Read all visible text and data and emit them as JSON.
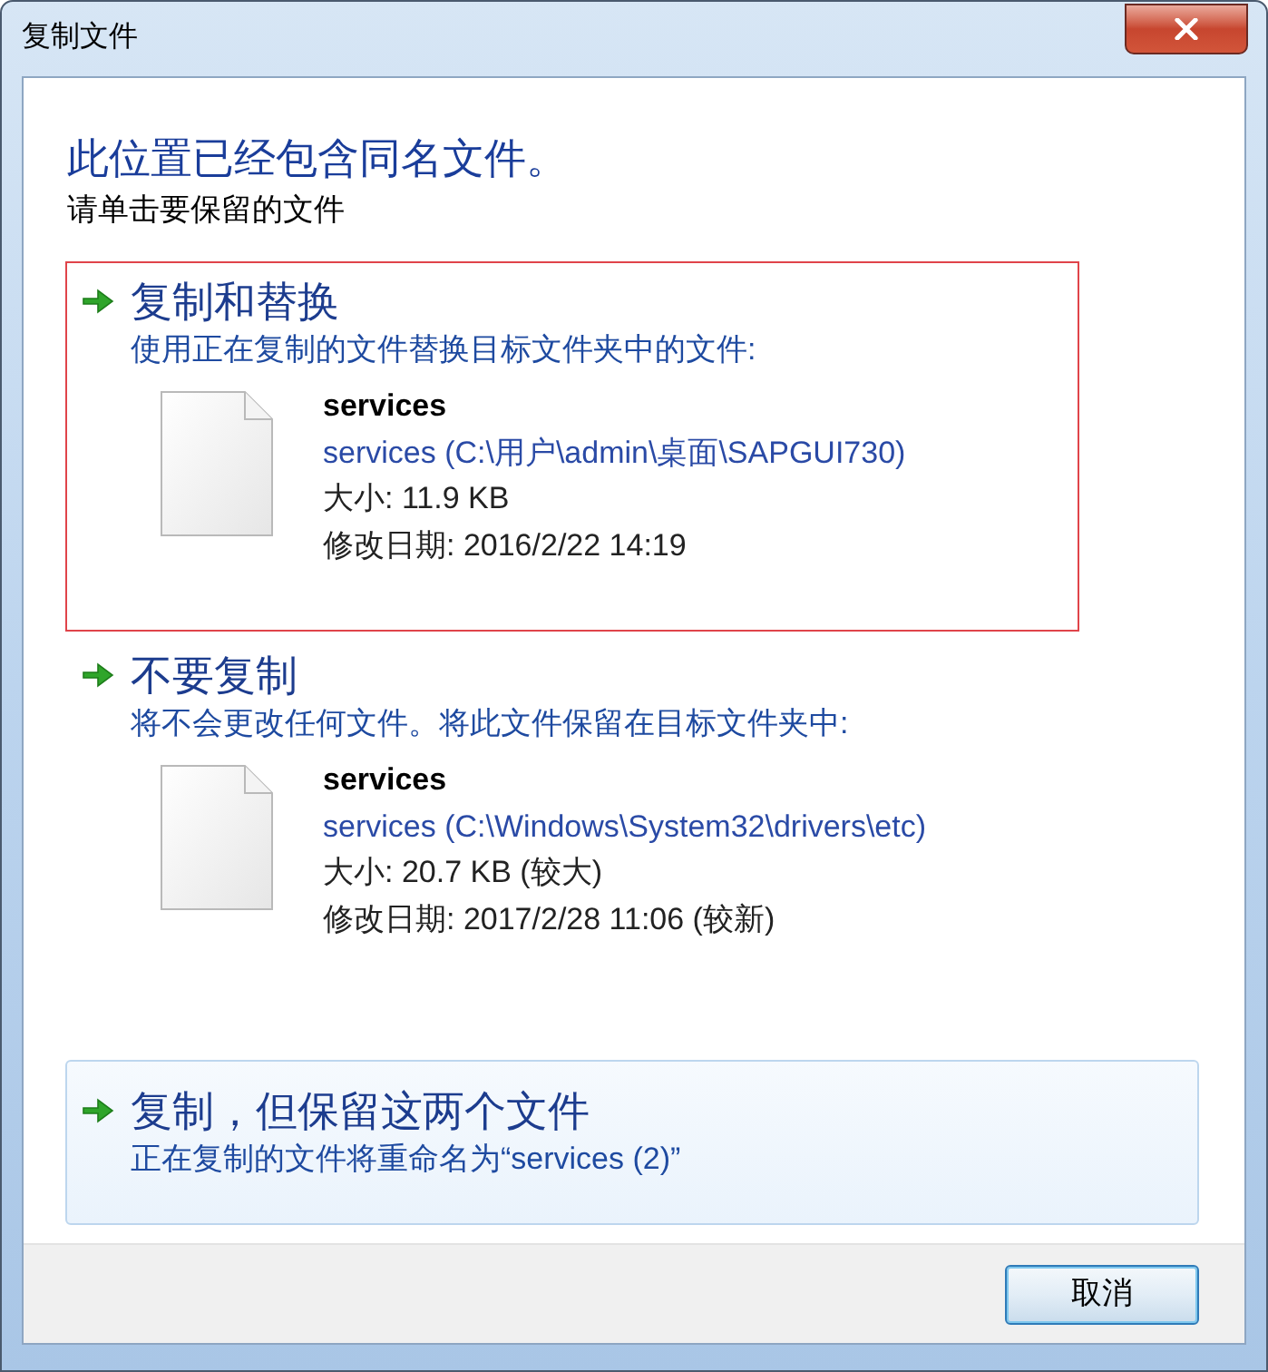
{
  "window": {
    "title": "复制文件"
  },
  "heading": "此位置已经包含同名文件。",
  "instruction": "请单击要保留的文件",
  "options": [
    {
      "title": "复制和替换",
      "description": "使用正在复制的文件替换目标文件夹中的文件:",
      "highlighted": true,
      "hovered": false,
      "file": {
        "name": "services",
        "location": "services (C:\\用户\\admin\\桌面\\SAPGUI730)",
        "size": "大小: 11.9 KB",
        "modified": "修改日期: 2016/2/22 14:19"
      }
    },
    {
      "title": "不要复制",
      "description": "将不会更改任何文件。将此文件保留在目标文件夹中:",
      "highlighted": false,
      "hovered": false,
      "file": {
        "name": "services",
        "location": "services (C:\\Windows\\System32\\drivers\\etc)",
        "size": "大小: 20.7 KB (较大)",
        "modified": "修改日期: 2017/2/28 11:06 (较新)"
      }
    },
    {
      "title": "复制，但保留这两个文件",
      "description": "正在复制的文件将重命名为“services (2)”",
      "highlighted": false,
      "hovered": true
    }
  ],
  "buttons": [
    {
      "label": "取消",
      "focused": true
    }
  ]
}
